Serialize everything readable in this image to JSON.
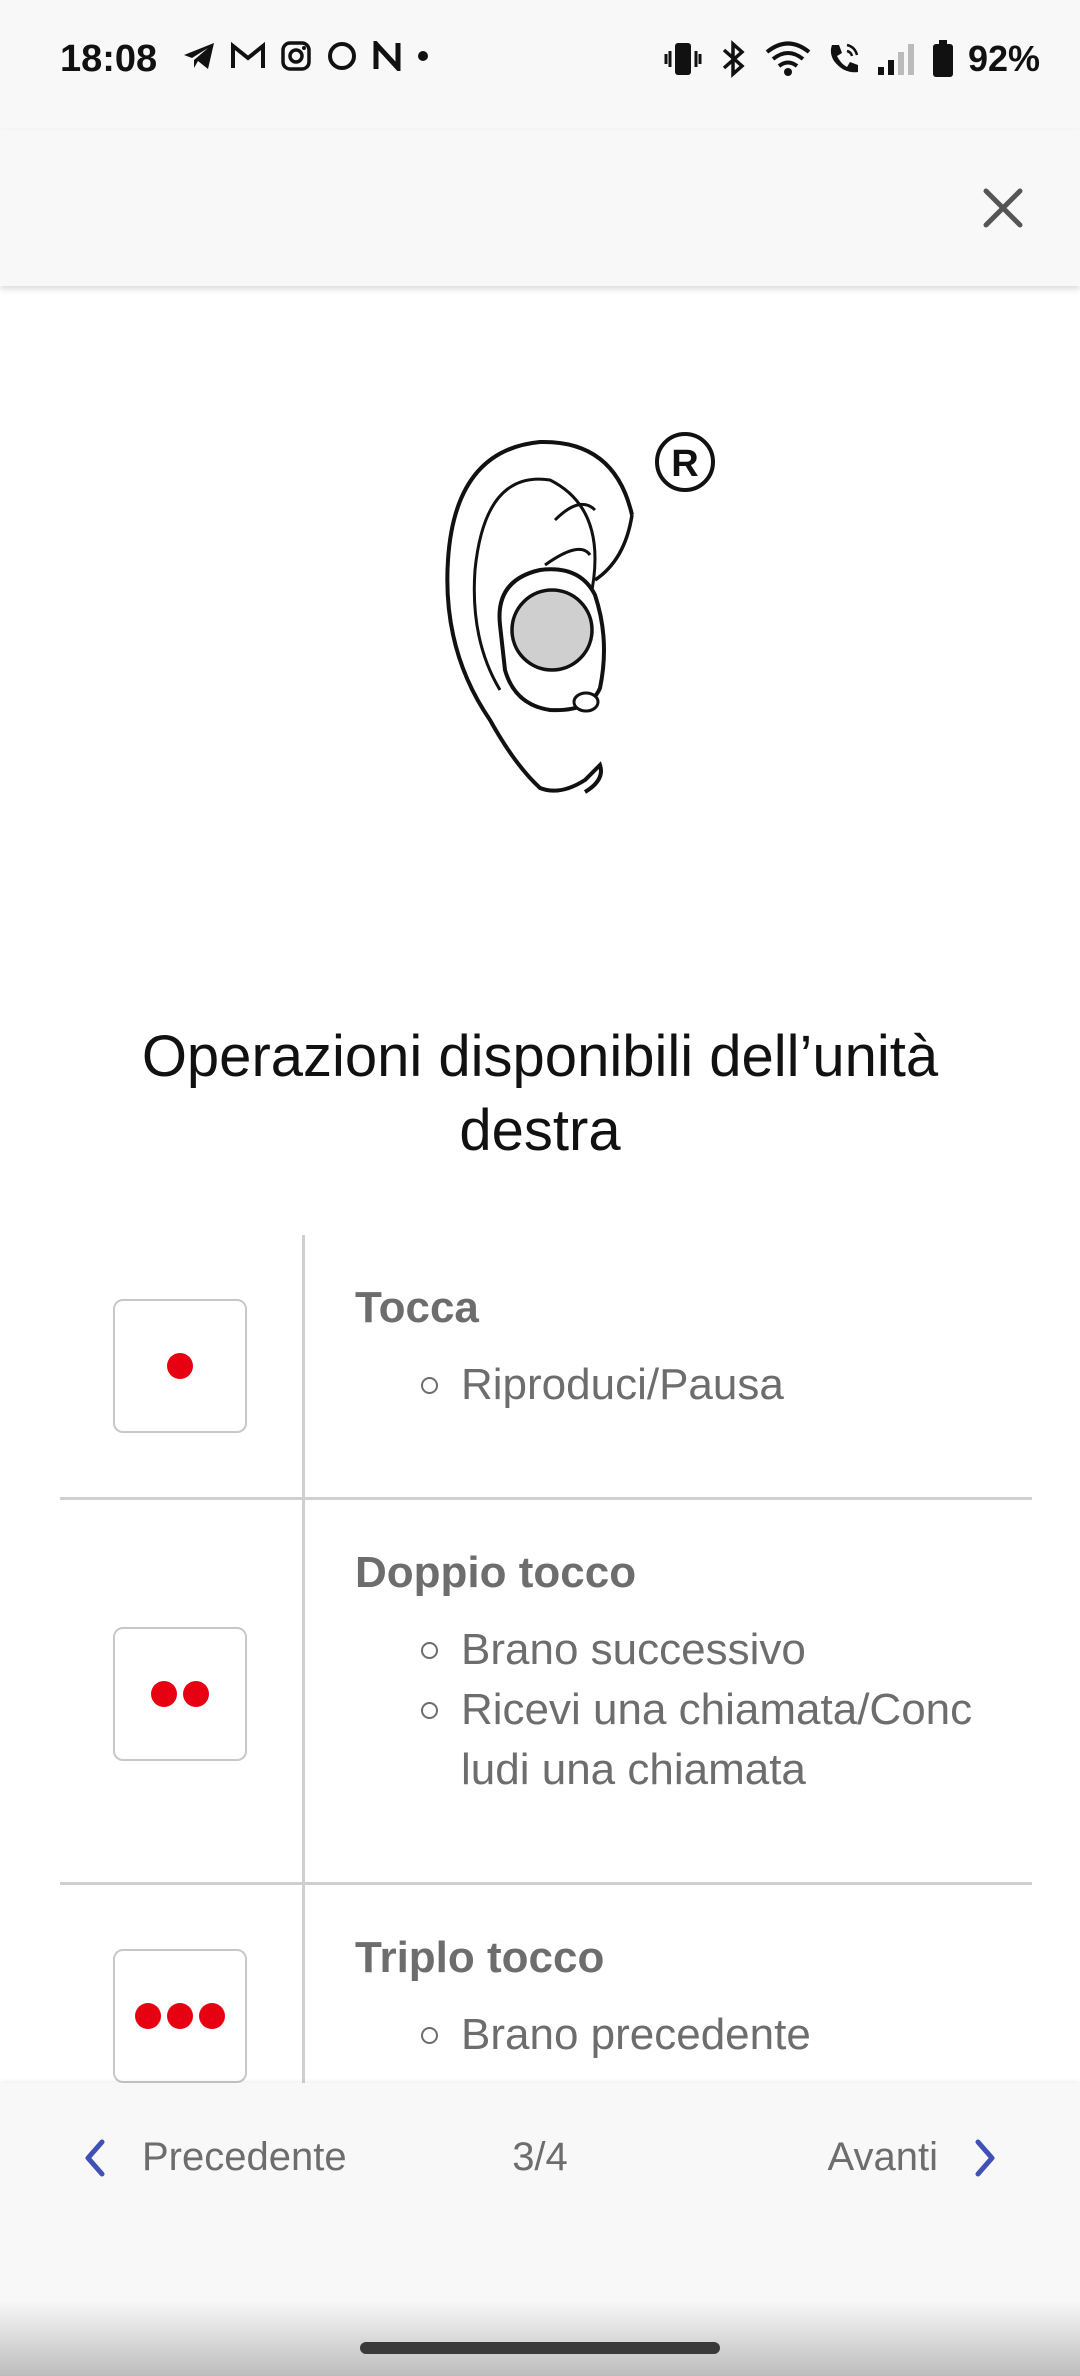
{
  "status_bar": {
    "time": "18:08",
    "battery": "92%",
    "notification_icons": [
      "telegram-icon",
      "gmail-icon",
      "instagram-icon",
      "threads-icon",
      "netflix-icon",
      "dot-icon"
    ],
    "system_icons": [
      "vibrate-icon",
      "bluetooth-icon",
      "wifi-icon",
      "call-icon",
      "signal-icon",
      "battery-icon"
    ]
  },
  "header": {
    "close_icon": "close-icon"
  },
  "illustration": {
    "badge": "R"
  },
  "title": "Operazioni disponibili dell’unità destra",
  "operations": [
    {
      "title": "Tocca",
      "taps": 1,
      "actions": [
        "Riproduci/Pausa"
      ]
    },
    {
      "title": "Doppio tocco",
      "taps": 2,
      "actions": [
        "Brano successivo",
        "Ricevi una chiamata/Concludi una chiamata"
      ]
    },
    {
      "title": "Triplo tocco",
      "taps": 3,
      "actions": [
        "Brano precedente"
      ]
    }
  ],
  "footer": {
    "prev_label": "Precedente",
    "next_label": "Avanti",
    "page": "3/4"
  },
  "colors": {
    "accent": "#3f51b5",
    "tap_dot": "#e60012",
    "text_secondary": "#6d6d6d"
  }
}
